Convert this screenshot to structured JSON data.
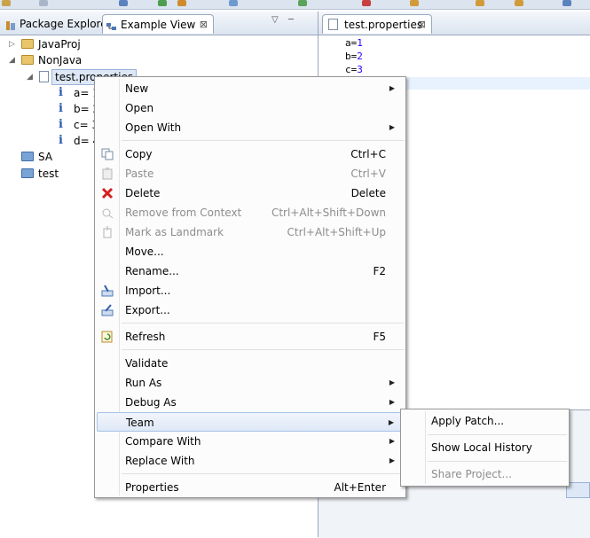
{
  "left_view": {
    "tabs": [
      {
        "label": "Package Explorer"
      },
      {
        "label": "Example View",
        "close": "⊠"
      }
    ],
    "view_menu": "▽",
    "minimize": "─",
    "tree": [
      {
        "label": "JavaProj",
        "icon": "project-icon"
      },
      {
        "label": "NonJava",
        "icon": "open-project-icon"
      },
      {
        "label": "test.properties",
        "icon": "properties-file-icon"
      },
      {
        "label": "a= 1",
        "icon": "info-icon",
        "glyph": "i"
      },
      {
        "label": "b= 2",
        "icon": "info-icon",
        "glyph": "i"
      },
      {
        "label": "c= 3",
        "icon": "info-icon",
        "glyph": "i"
      },
      {
        "label": "d= 4",
        "icon": "info-icon",
        "glyph": "i"
      },
      {
        "label": "SA",
        "icon": "folder-icon"
      },
      {
        "label": "test",
        "icon": "folder-icon"
      }
    ]
  },
  "editor": {
    "tab_label": "test.properties",
    "close": "⊠",
    "lines": [
      {
        "key": "a=",
        "val": "1"
      },
      {
        "key": "b=",
        "val": "2"
      },
      {
        "key": "c=",
        "val": "3"
      }
    ]
  },
  "context_menu": {
    "items": [
      {
        "label": "New",
        "shortcut": "",
        "submenu": true,
        "icon": ""
      },
      {
        "label": "Open",
        "shortcut": "",
        "submenu": false,
        "icon": ""
      },
      {
        "label": "Open With",
        "shortcut": "",
        "submenu": true,
        "icon": ""
      },
      {
        "label": "Copy",
        "shortcut": "Ctrl+C",
        "submenu": false,
        "icon": "copy-icon"
      },
      {
        "label": "Paste",
        "shortcut": "Ctrl+V",
        "submenu": false,
        "icon": "paste-icon",
        "disabled": true
      },
      {
        "label": "Delete",
        "shortcut": "Delete",
        "submenu": false,
        "icon": "delete-icon"
      },
      {
        "label": "Remove from Context",
        "shortcut": "Ctrl+Alt+Shift+Down",
        "submenu": false,
        "icon": "remove-context-icon",
        "disabled": true
      },
      {
        "label": "Mark as Landmark",
        "shortcut": "Ctrl+Alt+Shift+Up",
        "submenu": false,
        "icon": "landmark-icon",
        "disabled": true
      },
      {
        "label": "Move...",
        "shortcut": "",
        "submenu": false,
        "icon": ""
      },
      {
        "label": "Rename...",
        "shortcut": "F2",
        "submenu": false,
        "icon": ""
      },
      {
        "label": "Import...",
        "shortcut": "",
        "submenu": false,
        "icon": "import-icon"
      },
      {
        "label": "Export...",
        "shortcut": "",
        "submenu": false,
        "icon": "export-icon"
      },
      {
        "label": "Refresh",
        "shortcut": "F5",
        "submenu": false,
        "icon": "refresh-icon"
      },
      {
        "label": "Validate",
        "shortcut": "",
        "submenu": false,
        "icon": ""
      },
      {
        "label": "Run As",
        "shortcut": "",
        "submenu": true,
        "icon": ""
      },
      {
        "label": "Debug As",
        "shortcut": "",
        "submenu": true,
        "icon": ""
      },
      {
        "label": "Team",
        "shortcut": "",
        "submenu": true,
        "icon": "",
        "highlighted": true
      },
      {
        "label": "Compare With",
        "shortcut": "",
        "submenu": true,
        "icon": ""
      },
      {
        "label": "Replace With",
        "shortcut": "",
        "submenu": true,
        "icon": ""
      },
      {
        "label": "Properties",
        "shortcut": "Alt+Enter",
        "submenu": false,
        "icon": ""
      }
    ],
    "arrow": "▶"
  },
  "team_submenu": {
    "items": [
      {
        "label": "Apply Patch..."
      },
      {
        "label": "Show Local History"
      },
      {
        "label": "Share Project...",
        "disabled": true
      }
    ]
  },
  "colors": {
    "selection": "#dde7f5",
    "highlight_border": "#a8c2e6",
    "delete_red": "#d42020",
    "number_blue": "#2a00ff"
  }
}
